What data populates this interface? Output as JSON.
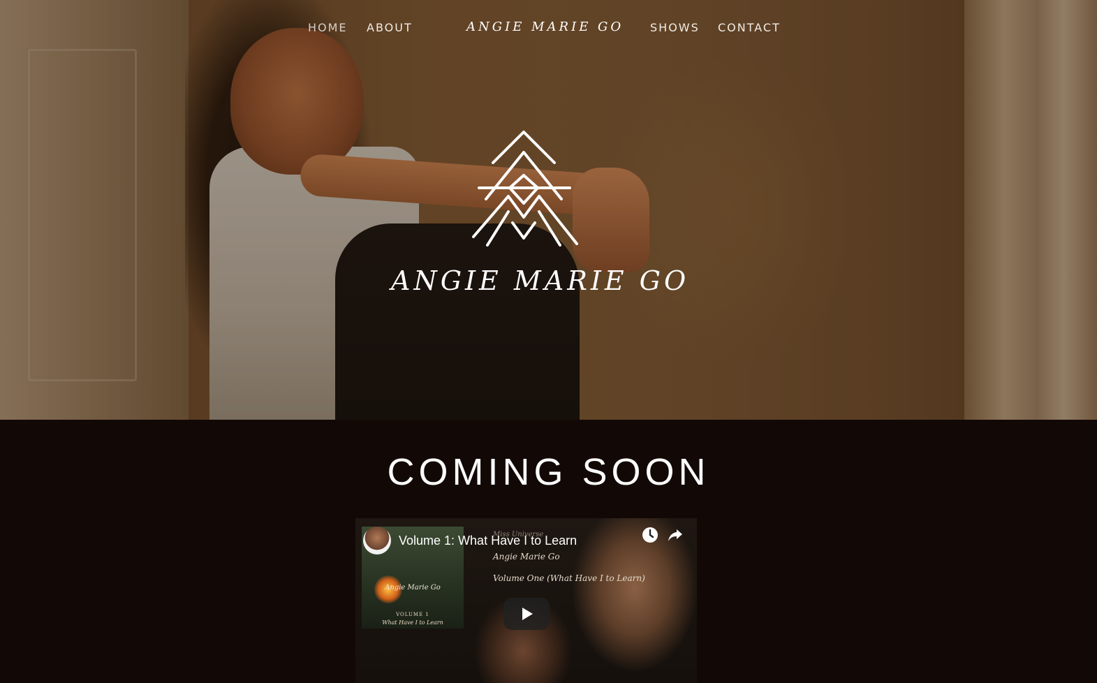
{
  "nav": {
    "left": [
      "HOME",
      "ABOUT"
    ],
    "brand": "ANGIE MARIE GO",
    "right": [
      "SHOWS",
      "CONTACT"
    ]
  },
  "hero": {
    "title": "ANGIE MARIE GO",
    "logo_icon": "am-triangle-monogram-icon"
  },
  "section": {
    "heading": "COMING SOON"
  },
  "video": {
    "title": "Volume 1: What Have I to Learn",
    "overlay_small": "Miss Universe",
    "overlay_artist": "Angie Marie Go",
    "overlay_volume": "Volume One (What Have I to Learn)",
    "thumbnail": {
      "artist": "Angie Marie Go",
      "volume": "VOLUME 1",
      "subtitle": "What Have I to Learn"
    },
    "icons": [
      "watch-later-icon",
      "share-icon",
      "play-icon"
    ]
  },
  "colors": {
    "page_bg": "#120907",
    "nav_text": "#f2ece6",
    "heading_text": "#ffffff"
  }
}
